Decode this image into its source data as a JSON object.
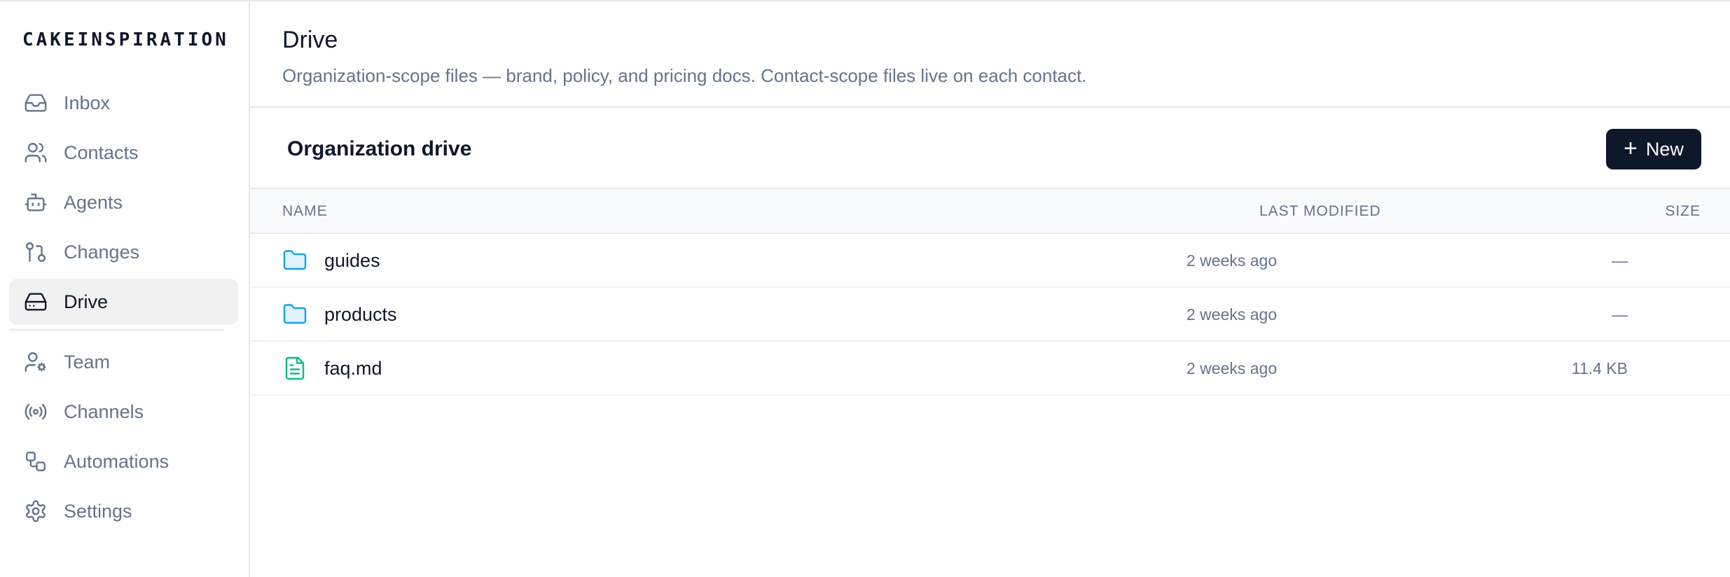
{
  "brand": "CAKEINSPIRATION",
  "sidebar": {
    "items": [
      {
        "label": "Inbox",
        "icon": "inbox-icon"
      },
      {
        "label": "Contacts",
        "icon": "users-icon"
      },
      {
        "label": "Agents",
        "icon": "bot-icon"
      },
      {
        "label": "Changes",
        "icon": "git-pull-request-icon"
      },
      {
        "label": "Drive",
        "icon": "hard-drive-icon",
        "active": true
      },
      {
        "label": "Team",
        "icon": "user-cog-icon"
      },
      {
        "label": "Channels",
        "icon": "radio-icon"
      },
      {
        "label": "Automations",
        "icon": "workflow-icon"
      },
      {
        "label": "Settings",
        "icon": "gear-icon"
      }
    ]
  },
  "header": {
    "title": "Drive",
    "subtitle": "Organization-scope files — brand, policy, and pricing docs. Contact-scope files live on each contact."
  },
  "section": {
    "title": "Organization drive",
    "new_label": "New",
    "new_icon": "plus-icon"
  },
  "table": {
    "columns": {
      "name": "NAME",
      "modified": "LAST MODIFIED",
      "size": "SIZE"
    },
    "rows": [
      {
        "name": "guides",
        "type": "folder",
        "icon": "folder-icon",
        "modified": "2 weeks ago",
        "size": "—"
      },
      {
        "name": "products",
        "type": "folder",
        "icon": "folder-icon",
        "modified": "2 weeks ago",
        "size": "—"
      },
      {
        "name": "faq.md",
        "type": "file",
        "icon": "file-text-icon",
        "modified": "2 weeks ago",
        "size": "11.4 KB"
      }
    ]
  },
  "colors": {
    "primary": "#0f172a",
    "muted": "#64748b",
    "folder": "#0ea5e9",
    "file": "#10b981",
    "active_bg": "#f1f1f2"
  }
}
